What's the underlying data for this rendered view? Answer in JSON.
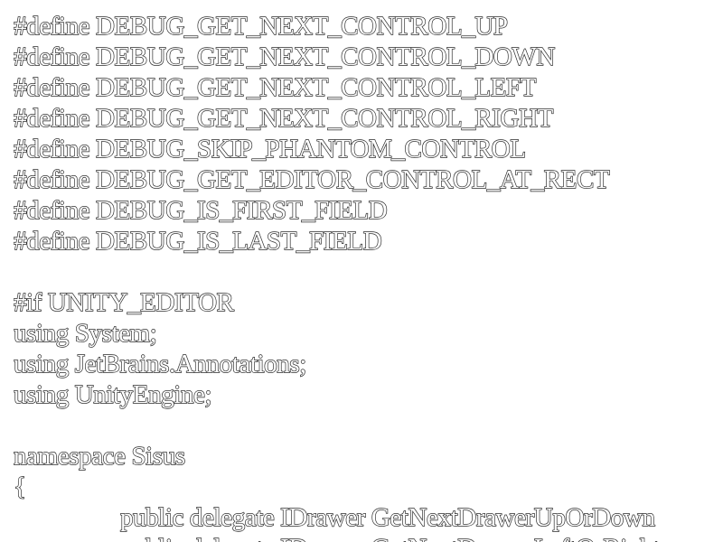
{
  "editor": {
    "lines": [
      "#define DEBUG_GET_NEXT_CONTROL_UP",
      "#define DEBUG_GET_NEXT_CONTROL_DOWN",
      "#define DEBUG_GET_NEXT_CONTROL_LEFT",
      "#define DEBUG_GET_NEXT_CONTROL_RIGHT",
      "#define DEBUG_SKIP_PHANTOM_CONTROL",
      "#define DEBUG_GET_EDITOR_CONTROL_AT_RECT",
      "#define DEBUG_IS_FIRST_FIELD",
      "#define DEBUG_IS_LAST_FIELD",
      "",
      "#if UNITY_EDITOR",
      "using System;",
      "using JetBrains.Annotations;",
      "using UnityEngine;",
      "",
      "namespace Sisus",
      "{",
      "public delegate IDrawer GetNextDrawerUpOrDown",
      "public delegate IDrawer GetNextDrawerLeftOrRight"
    ]
  }
}
